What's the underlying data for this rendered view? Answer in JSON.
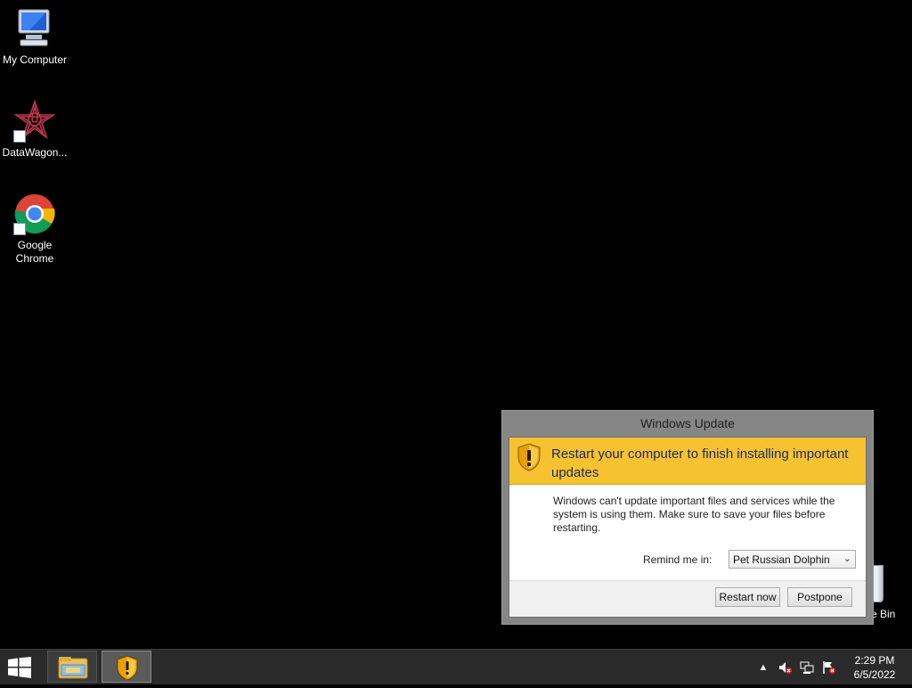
{
  "desktop": {
    "icons": [
      {
        "label": "My Computer"
      },
      {
        "label": "DataWagon..."
      },
      {
        "label": "Google Chrome"
      }
    ],
    "recycle_bin_label_partial": "e Bin"
  },
  "dialog": {
    "title": "Windows Update",
    "header": "Restart your computer to finish installing important updates",
    "body": "Windows can't update important files and services while the system is using them. Make sure to save your files before restarting.",
    "remind_label": "Remind me in:",
    "remind_value": "Pet Russian Dolphin",
    "restart_button": "Restart now",
    "postpone_button": "Postpone"
  },
  "taskbar": {
    "time": "2:29 PM",
    "date": "6/5/2022"
  },
  "colors": {
    "dialog_header": "#f6c230",
    "taskbar": "#2b2b2b",
    "desktop": "#000000"
  }
}
